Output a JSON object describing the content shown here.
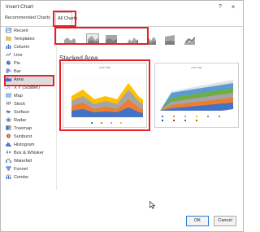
{
  "dialog": {
    "title": "Insert Chart",
    "help": "?",
    "close": "×"
  },
  "tabs": {
    "recommended": "Recommended Charts",
    "all": "All Charts"
  },
  "sidebar": {
    "items": [
      {
        "label": "Recent",
        "icon": "recent-icon"
      },
      {
        "label": "Templates",
        "icon": "templates-icon"
      },
      {
        "label": "Column",
        "icon": "column-chart-icon"
      },
      {
        "label": "Line",
        "icon": "line-chart-icon"
      },
      {
        "label": "Pie",
        "icon": "pie-chart-icon"
      },
      {
        "label": "Bar",
        "icon": "bar-chart-icon"
      },
      {
        "label": "Area",
        "icon": "area-chart-icon"
      },
      {
        "label": "X Y (Scatter)",
        "icon": "scatter-chart-icon"
      },
      {
        "label": "Map",
        "icon": "map-chart-icon"
      },
      {
        "label": "Stock",
        "icon": "stock-chart-icon"
      },
      {
        "label": "Surface",
        "icon": "surface-chart-icon"
      },
      {
        "label": "Radar",
        "icon": "radar-chart-icon"
      },
      {
        "label": "Treemap",
        "icon": "treemap-chart-icon"
      },
      {
        "label": "Sunburst",
        "icon": "sunburst-chart-icon"
      },
      {
        "label": "Histogram",
        "icon": "histogram-chart-icon"
      },
      {
        "label": "Box & Whisker",
        "icon": "box-whisker-chart-icon"
      },
      {
        "label": "Waterfall",
        "icon": "waterfall-chart-icon"
      },
      {
        "label": "Funnel",
        "icon": "funnel-chart-icon"
      },
      {
        "label": "Combo",
        "icon": "combo-chart-icon"
      }
    ],
    "selected": "Area"
  },
  "main": {
    "section_title": "Stacked Area",
    "previews": [
      {
        "title": "Chart Title"
      },
      {
        "title": "Chart Title"
      }
    ]
  },
  "footer": {
    "ok": "OK",
    "cancel": "Cancel"
  },
  "colors": {
    "highlight": "#e52028",
    "area_blue": "#4472c4",
    "area_orange": "#ed7d31",
    "area_gray": "#a5a5a5",
    "area_yellow": "#ffc000",
    "area_teal": "#5b9bd5",
    "area_green": "#70ad47"
  }
}
